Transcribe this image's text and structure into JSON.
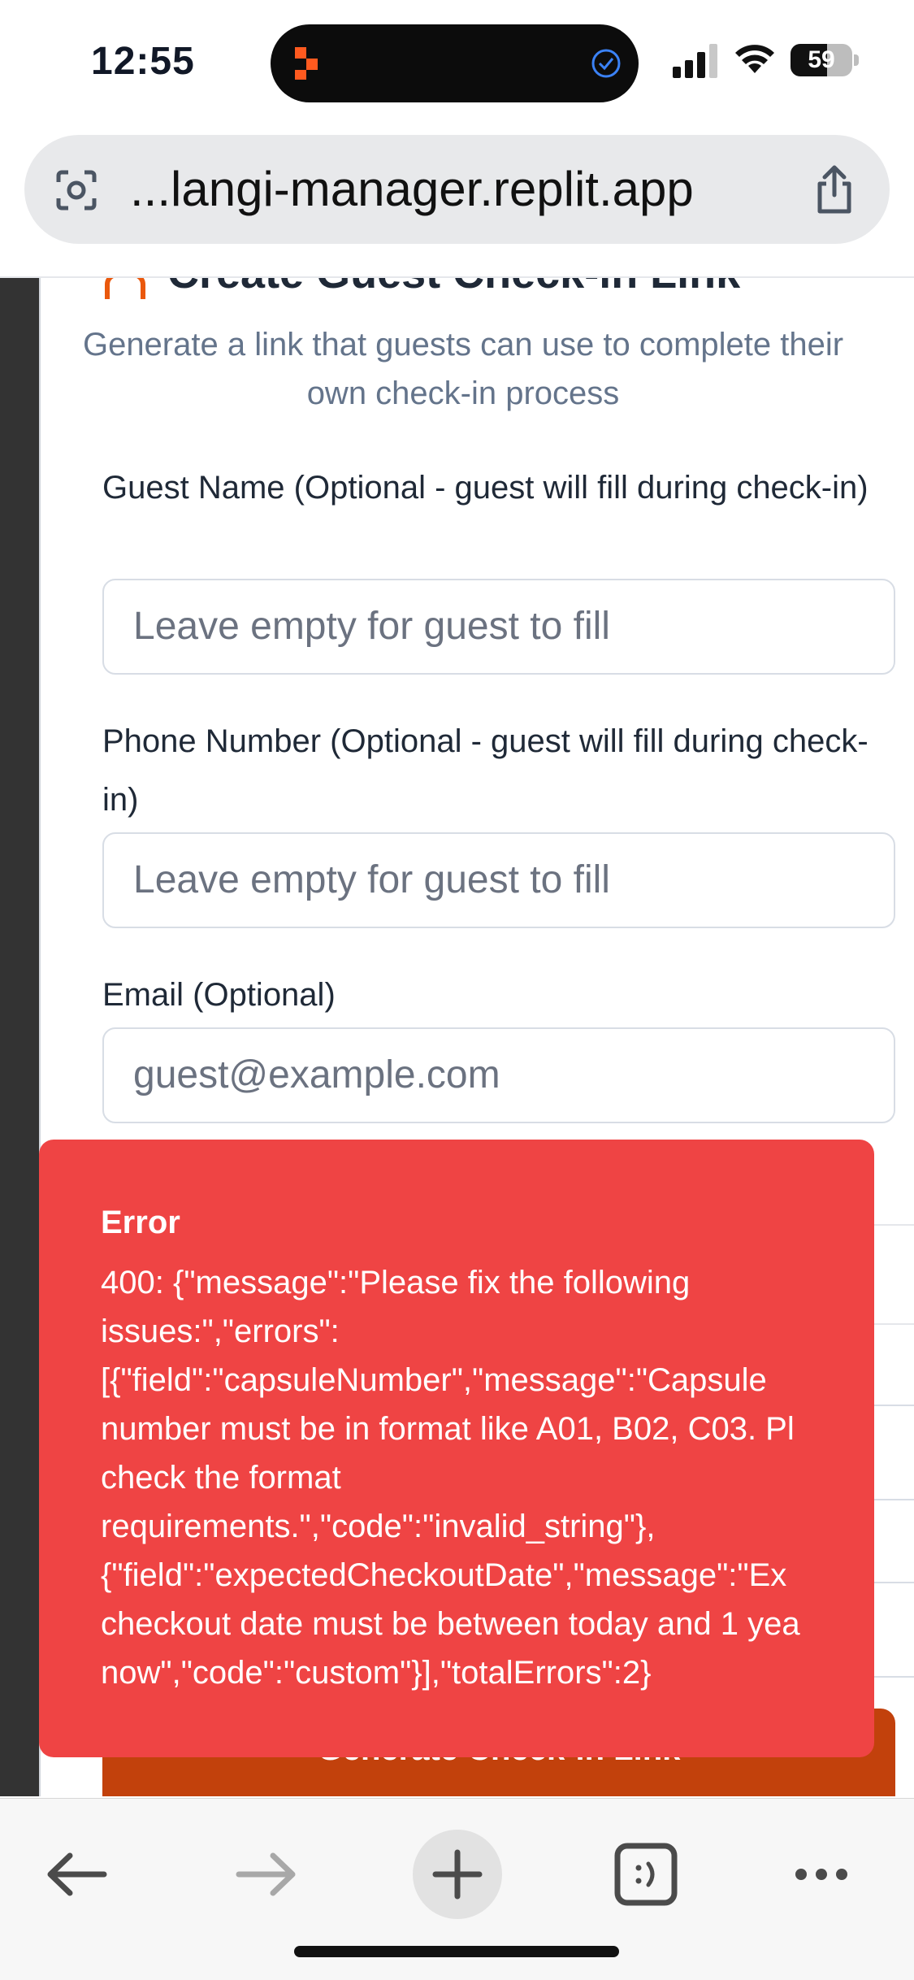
{
  "status_bar": {
    "time": "12:55",
    "battery_text": "59",
    "battery_level": 0.59
  },
  "browser": {
    "url": "...langi-manager.replit.app"
  },
  "form": {
    "title": "Create Guest Check-in Link",
    "description": "Generate a link that guests can use to complete their own check-in process",
    "guest_name_label": "Guest Name (Optional - guest will fill during check-in)",
    "guest_name_placeholder": "Leave empty for guest to fill",
    "phone_label": "Phone Number (Optional - guest will fill during check-in)",
    "phone_placeholder": "Leave empty for guest to fill",
    "email_label": "Email (Optional)",
    "email_placeholder": "guest@example.com",
    "submit_label": "Generate Check-in Link"
  },
  "toast": {
    "title": "Error",
    "message_lines": [
      "400: {\"message\":\"Please fix the following",
      "issues:\",\"errors\":",
      "[{\"field\":\"capsuleNumber\",\"message\":\"Capsule",
      "number must be in format like A01, B02, C03. Pl",
      "check the format",
      "requirements.\",\"code\":\"invalid_string\"},",
      "{\"field\":\"expectedCheckoutDate\",\"message\":\"Ex",
      "checkout date must be between today and 1 yea",
      "now\",\"code\":\"custom\"}],\"totalErrors\":2}"
    ]
  },
  "colors": {
    "accent": "#c2410c",
    "error": "#ef4444"
  },
  "icons": {
    "toolbar": [
      "back-arrow-icon",
      "forward-arrow-icon",
      "new-tab-plus-icon",
      "tabs-icon",
      "more-icon"
    ]
  }
}
